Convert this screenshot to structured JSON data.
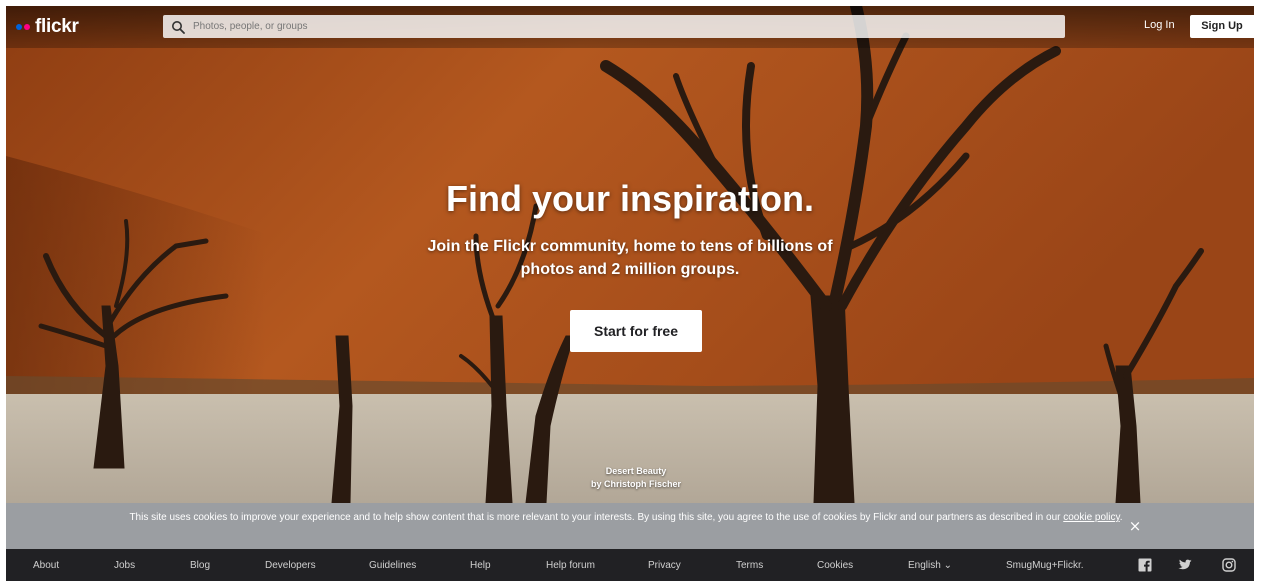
{
  "header": {
    "logo_text": "flickr",
    "search_placeholder": "Photos, people, or groups",
    "login_label": "Log In",
    "signup_label": "Sign Up"
  },
  "hero": {
    "headline": "Find your inspiration.",
    "subline": "Join the Flickr community, home to tens of billions of photos and 2 million groups.",
    "cta_label": "Start for free",
    "credit_title": "Desert Beauty",
    "credit_author": "by Christoph Fischer"
  },
  "cookie_banner": {
    "text": "This site uses cookies to improve your experience and to help show content that is more relevant to your interests. By using this site, you agree to the use of cookies by Flickr and our partners as described in our",
    "link_label": "cookie policy",
    "suffix": ".",
    "close_label": "×"
  },
  "footer": {
    "links": [
      "About",
      "Jobs",
      "Blog",
      "Developers",
      "Guidelines",
      "Help",
      "Help forum",
      "Privacy",
      "Terms",
      "Cookies",
      "English ⌄",
      "SmugMug+Flickr."
    ],
    "social": [
      "facebook-icon",
      "twitter-icon",
      "instagram-icon"
    ]
  },
  "colors": {
    "flickr_blue": "#0063dc",
    "flickr_pink": "#ff0084",
    "footer_bg": "#212124",
    "cookie_bg": "#9b9ea2"
  }
}
